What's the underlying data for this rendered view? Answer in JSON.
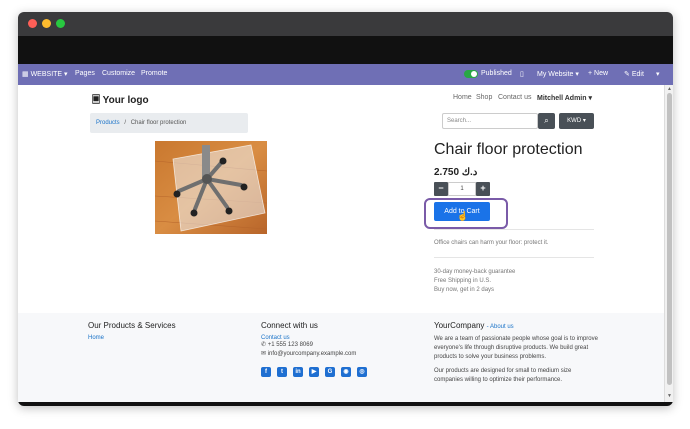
{
  "topbar": {
    "website_menu": "WEBSITE",
    "pages": "Pages",
    "customize": "Customize",
    "promote": "Promote",
    "published": "Published",
    "my_website": "My Website",
    "new": "New",
    "edit": "Edit"
  },
  "header": {
    "logo": "Your logo",
    "nav": [
      "Home",
      "Shop",
      "Contact us"
    ],
    "user": "Mitchell Admin"
  },
  "breadcrumb": {
    "parent": "Products",
    "separator": "/",
    "current": "Chair floor protection"
  },
  "search": {
    "placeholder": "Search...",
    "currency": "KWD"
  },
  "product": {
    "title": "Chair floor protection",
    "price": "2.750 د.ك",
    "quantity": "1",
    "add_to_cart": "Add to Cart",
    "description": "Office chairs can harm your floor: protect it.",
    "features": [
      "30-day money-back guarantee",
      "Free Shipping in U.S.",
      "Buy now, get in 2 days"
    ]
  },
  "footer": {
    "col1_title": "Our Products & Services",
    "col1_link": "Home",
    "col2_title": "Connect with us",
    "contact_link": "Contact us",
    "phone": "+1 555 123 8069",
    "email": "info@yourcompany.example.com",
    "col3_title": "YourCompany",
    "about_link": "About us",
    "about_text1": "We are a team of passionate people whose goal is to improve everyone's life through disruptive products. We build great products to solve your business problems.",
    "about_text2": "Our products are designed for small to medium size companies willing to optimize their performance."
  },
  "colors": {
    "topbar": "#6f6fb5",
    "primary": "#1a73e8",
    "highlight": "#7a5ba8",
    "dark_button": "#495057"
  }
}
